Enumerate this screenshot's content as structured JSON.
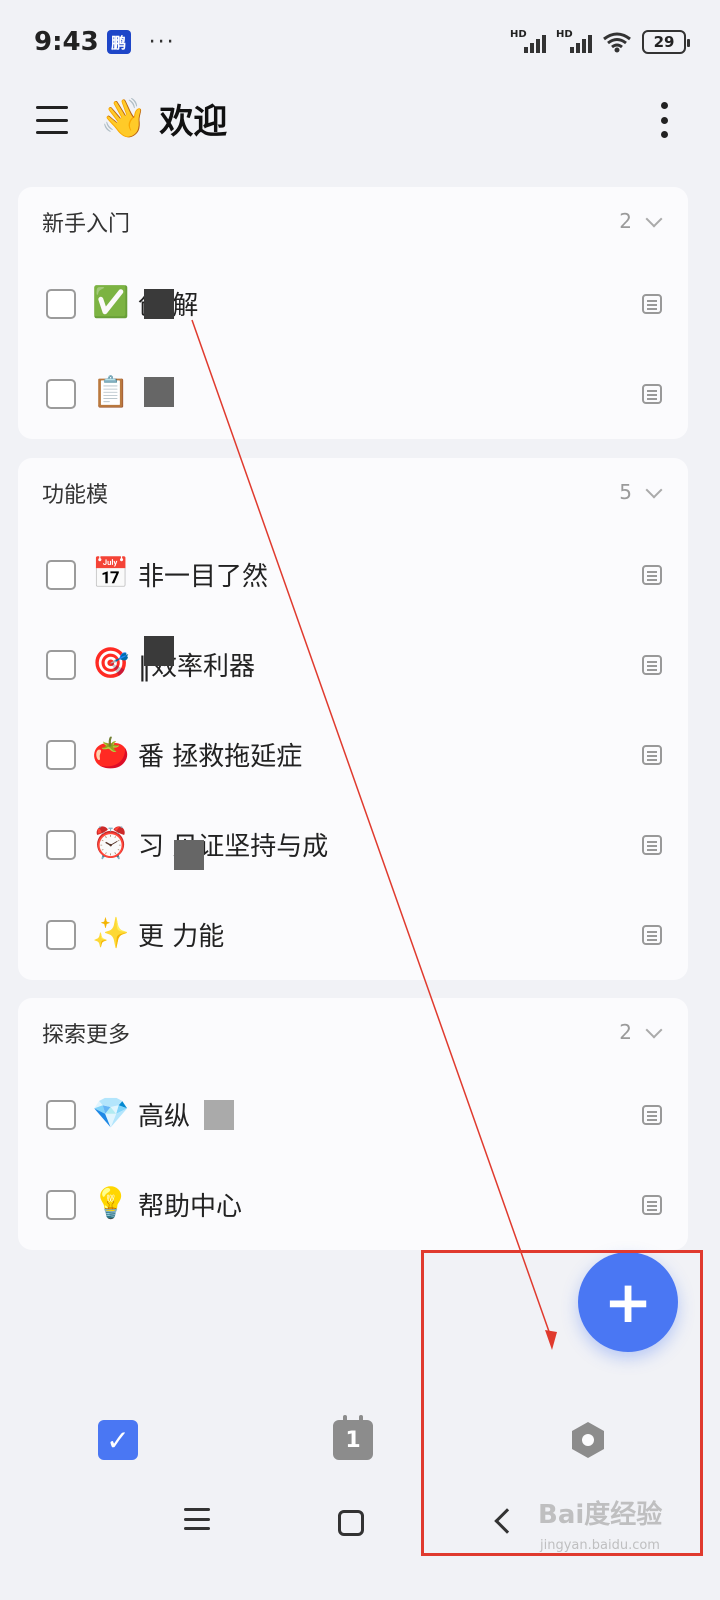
{
  "status_bar": {
    "time": "9:43",
    "carrier_badge": "鹏",
    "dots": "···",
    "hd1": "HD",
    "hd2": "HD",
    "battery": "29"
  },
  "app_bar": {
    "emoji": "👋",
    "title": "欢迎"
  },
  "sections": [
    {
      "title": "新手入门",
      "count": "2",
      "items": [
        {
          "emoji": "✅",
          "text": "创        解 "
        },
        {
          "emoji": "📋",
          "text": ""
        }
      ]
    },
    {
      "title": "功能模",
      "count": "5",
      "items": [
        {
          "emoji": "📅",
          "text": "                非一目了然"
        },
        {
          "emoji": "🎯",
          "text": "       ‖效率利器"
        },
        {
          "emoji": "🍅",
          "text": "番        拯救拖延症"
        },
        {
          "emoji": "⏰",
          "text": "习         见证坚持与成"
        },
        {
          "emoji": "✨",
          "text": "更     力能"
        }
      ]
    },
    {
      "title": "探索更多",
      "count": "2",
      "items": [
        {
          "emoji": "💎",
          "text": "高纵"
        },
        {
          "emoji": "💡",
          "text": "帮助中心"
        }
      ]
    }
  ],
  "fab": {
    "symbol": "+"
  },
  "bottom_nav": {
    "tasks_glyph": "✓",
    "calendar_glyph": "1"
  },
  "watermark": {
    "main": "Bai度经验",
    "sub": "jingyan.baidu.com"
  },
  "colors": {
    "accent": "#4a77f3",
    "annotation": "#e03a2e",
    "background": "#f1f2f6"
  }
}
